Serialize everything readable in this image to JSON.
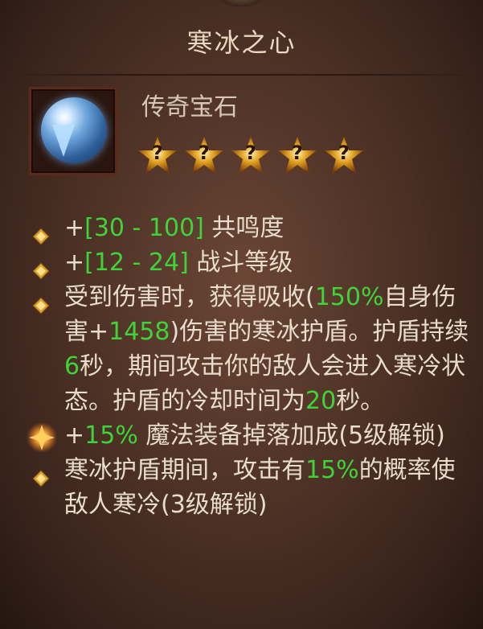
{
  "tooltip": {
    "title": "寒冰之心",
    "item_type": "传奇宝石",
    "star_count": 5,
    "star_symbol": "?",
    "colors": {
      "highlight_green": "#3fd33a",
      "text": "#e8dccb",
      "star_gold": "#e0a020"
    },
    "icon_name": "frost-orb-gem-icon",
    "stats": [
      {
        "bullet": "diamond-bullet-icon",
        "parts": [
          {
            "t": "+",
            "hl": false
          },
          {
            "t": "[30 - 100]",
            "hl": true
          },
          {
            "t": " 共鸣度",
            "hl": false
          }
        ]
      },
      {
        "bullet": "diamond-bullet-icon",
        "parts": [
          {
            "t": "+",
            "hl": false
          },
          {
            "t": "[12 - 24]",
            "hl": true
          },
          {
            "t": " 战斗等级",
            "hl": false
          }
        ]
      },
      {
        "bullet": "diamond-bullet-icon",
        "parts": [
          {
            "t": "受到伤害时，获得吸收(",
            "hl": false
          },
          {
            "t": "150%",
            "hl": true
          },
          {
            "t": "自身伤害+",
            "hl": false
          },
          {
            "t": "1458",
            "hl": true
          },
          {
            "t": ")伤害的寒冰护盾。护盾持续",
            "hl": false
          },
          {
            "t": "6",
            "hl": true
          },
          {
            "t": "秒，期间攻击你的敌人会进入寒冷状态。护盾的冷却时间为",
            "hl": false
          },
          {
            "t": "20",
            "hl": true
          },
          {
            "t": "秒。",
            "hl": false
          }
        ]
      },
      {
        "bullet": "glowing-diamond-bullet-icon",
        "parts": [
          {
            "t": "+",
            "hl": false
          },
          {
            "t": "15%",
            "hl": true
          },
          {
            "t": " 魔法装备掉落加成(5级解锁)",
            "hl": false
          }
        ]
      },
      {
        "bullet": "diamond-bullet-icon",
        "parts": [
          {
            "t": "寒冰护盾期间，攻击有",
            "hl": false
          },
          {
            "t": "15%",
            "hl": true
          },
          {
            "t": "的概率使敌人寒冷(3级解锁)",
            "hl": false
          }
        ]
      }
    ]
  }
}
